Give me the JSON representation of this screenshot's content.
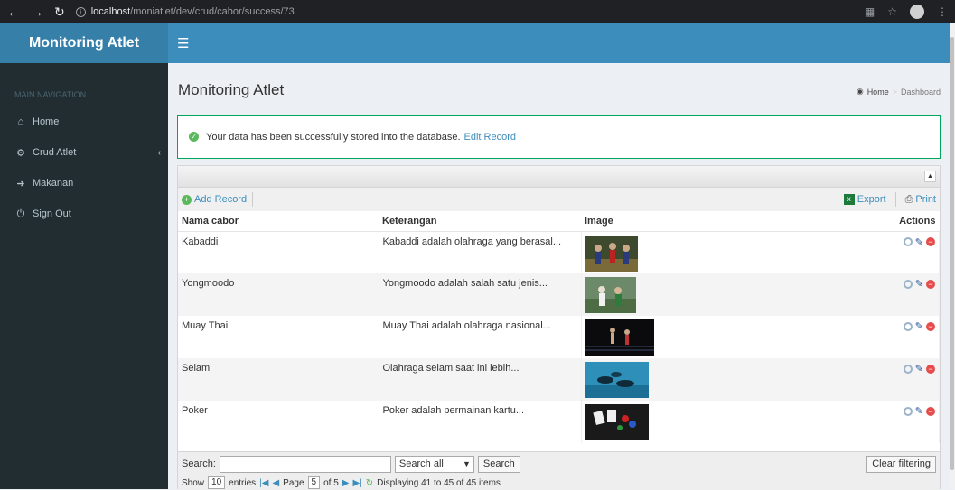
{
  "browser": {
    "url_host": "localhost",
    "url_path": "/moniatlet/dev/crud/cabor/success/73"
  },
  "brand": "Monitoring Atlet",
  "sidebar": {
    "section": "MAIN NAVIGATION",
    "items": [
      {
        "label": "Home",
        "icon": "home-icon"
      },
      {
        "label": "Crud Atlet",
        "icon": "gear-icon"
      },
      {
        "label": "Makanan",
        "icon": "sign-in-icon"
      },
      {
        "label": "Sign Out",
        "icon": "power-icon"
      }
    ]
  },
  "page": {
    "title": "Monitoring Atlet",
    "breadcrumb_home": "Home",
    "breadcrumb_current": "Dashboard"
  },
  "alert": {
    "message": "Your data has been successfully stored into the database.",
    "link": "Edit Record"
  },
  "toolbar": {
    "add": "Add Record",
    "export": "Export",
    "print": "Print"
  },
  "table": {
    "columns": [
      "Nama cabor",
      "Keterangan",
      "Image",
      "Actions"
    ],
    "rows": [
      {
        "nama": "Kabaddi",
        "keterangan": "Kabaddi adalah olahraga yang berasal..."
      },
      {
        "nama": "Yongmoodo",
        "keterangan": "Yongmoodo adalah salah satu jenis..."
      },
      {
        "nama": "Muay Thai",
        "keterangan": "Muay Thai adalah olahraga nasional..."
      },
      {
        "nama": "Selam",
        "keterangan": "Olahraga selam saat ini lebih..."
      },
      {
        "nama": "Poker",
        "keterangan": "Poker adalah permainan kartu..."
      }
    ]
  },
  "search": {
    "label": "Search:",
    "value": "",
    "select": "Search all",
    "button": "Search",
    "clear": "Clear filtering"
  },
  "pager": {
    "show": "Show",
    "per_page": "10",
    "entries": "entries",
    "page_label": "Page",
    "page": "5",
    "of": "of 5",
    "displaying": "Displaying 41 to 45 of 45 items"
  }
}
